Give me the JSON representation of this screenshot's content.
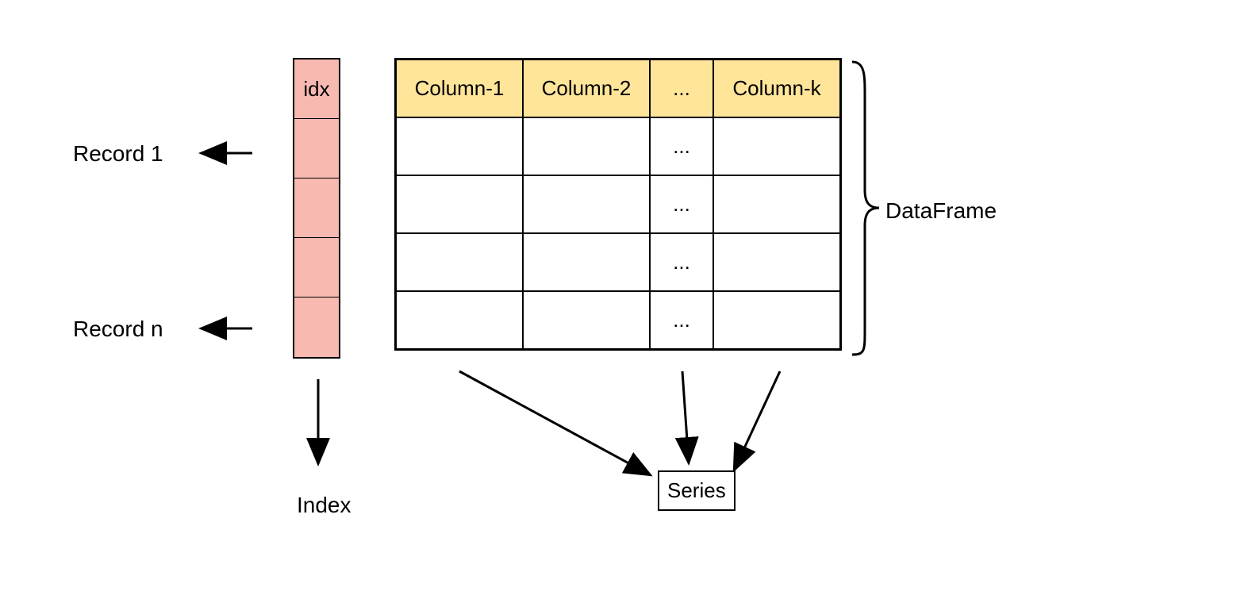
{
  "diagram": {
    "idx_header": "idx",
    "columns": [
      "Column-1",
      "Column-2",
      "...",
      "Column-k"
    ],
    "ellipsis_column_values": [
      "...",
      "...",
      "...",
      "..."
    ],
    "labels": {
      "record_1": "Record 1",
      "record_n": "Record n",
      "index": "Index",
      "dataframe": "DataFrame",
      "series": "Series"
    },
    "colors": {
      "idx_fill": "#f8b9b1",
      "column_header_fill": "#fee599"
    }
  }
}
